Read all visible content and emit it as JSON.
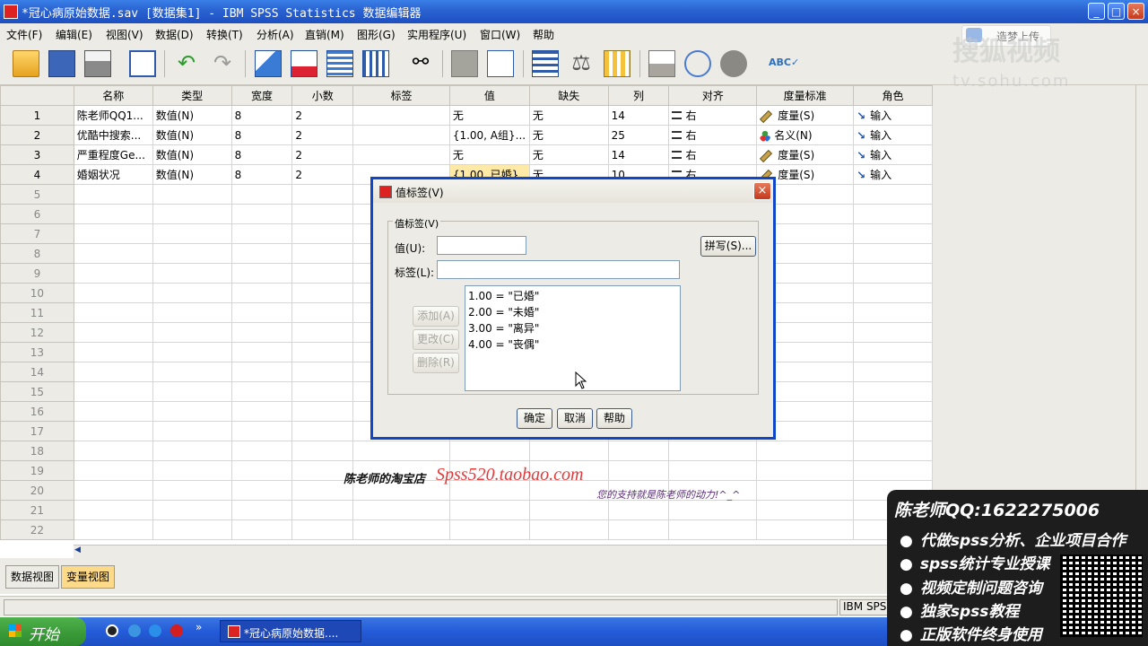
{
  "window": {
    "title": "*冠心病原始数据.sav [数据集1] - IBM SPSS Statistics 数据编辑器",
    "minimize": "_",
    "maximize": "□",
    "close": "×"
  },
  "menu": [
    "文件(F)",
    "编辑(E)",
    "视图(V)",
    "数据(D)",
    "转换(T)",
    "分析(A)",
    "直销(M)",
    "图形(G)",
    "实用程序(U)",
    "窗口(W)",
    "帮助"
  ],
  "toolbar_icons": [
    "open-icon",
    "save-icon",
    "print-icon",
    "recall-dialog-icon",
    "undo-icon",
    "redo-icon",
    "goto-case-icon",
    "goto-variable-icon",
    "variables-icon",
    "run-descriptives-icon",
    "find-icon",
    "insert-cases-icon",
    "insert-variable-icon",
    "split-file-icon",
    "weight-cases-icon",
    "select-cases-icon",
    "value-labels-icon",
    "use-sets-icon",
    "show-all-variables-icon",
    "spell-check-icon"
  ],
  "grid": {
    "columns": [
      "名称",
      "类型",
      "宽度",
      "小数",
      "标签",
      "值",
      "缺失",
      "列",
      "对齐",
      "度量标准",
      "角色"
    ],
    "rows": [
      {
        "n": "1",
        "cells": [
          "陈老师QQ1...",
          "数值(N)",
          "8",
          "2",
          "",
          "无",
          "无",
          "14",
          "右",
          "度量(S)",
          "输入"
        ],
        "measure_icon": "ruler"
      },
      {
        "n": "2",
        "cells": [
          "优酷中搜索...",
          "数值(N)",
          "8",
          "2",
          "",
          "{1.00, A组}...",
          "无",
          "25",
          "右",
          "名义(N)",
          "输入"
        ],
        "measure_icon": "nominal"
      },
      {
        "n": "3",
        "cells": [
          "严重程度Ge...",
          "数值(N)",
          "8",
          "2",
          "",
          "无",
          "无",
          "14",
          "右",
          "度量(S)",
          "输入"
        ],
        "measure_icon": "ruler"
      },
      {
        "n": "4",
        "cells": [
          "婚姻状况",
          "数值(N)",
          "8",
          "2",
          "",
          "{1.00, 已婚}...",
          "无",
          "10",
          "右",
          "度量(S)",
          "输入"
        ],
        "measure_icon": "ruler"
      }
    ],
    "empty_rows": [
      "5",
      "6",
      "7",
      "8",
      "9",
      "10",
      "11",
      "12",
      "13",
      "14",
      "15",
      "16",
      "17",
      "18",
      "19",
      "20",
      "21",
      "22"
    ]
  },
  "tabs": {
    "data_view": "数据视图",
    "variable_view": "变量视图"
  },
  "status": {
    "processor": "IBM SPSS"
  },
  "taskbar": {
    "start": "开始",
    "task": "*冠心病原始数据...."
  },
  "dialog": {
    "title": "值标签(V)",
    "group": "值标签(V)",
    "value_label": "值(U):",
    "label_label": "标签(L):",
    "value_input": "",
    "label_input": "",
    "spell": "拼写(S)...",
    "add": "添加(A)",
    "change": "更改(C)",
    "remove": "删除(R)",
    "list": [
      "1.00 = \"已婚\"",
      "2.00 = \"未婚\"",
      "3.00 = \"离异\"",
      "4.00 = \"丧偶\""
    ],
    "ok": "确定",
    "cancel": "取消",
    "help": "帮助"
  },
  "overlay": {
    "shop_label": "陈老师的淘宝店",
    "shop_url": "Spss520.taobao.com",
    "support": "您的支持就是陈老师的动力!^_^",
    "watermark_upload": "造梦上传",
    "watermark_brand": "搜狐视频",
    "watermark_url": "tv.sohu.com",
    "promo": {
      "qq": "陈老师QQ:1622275006",
      "lines": [
        "代做spss分析、企业项目合作",
        "spss统计专业授课",
        "视频定制问题咨询",
        "独家spss教程",
        "正版软件终身使用"
      ]
    }
  }
}
